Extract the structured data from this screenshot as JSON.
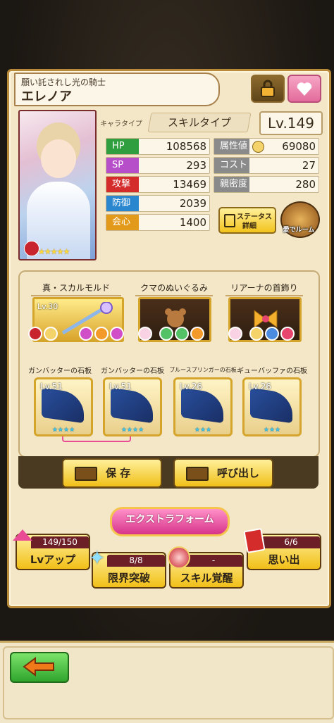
{
  "header": {
    "subtitle": "願い託されし光の騎士",
    "name": "エレノア"
  },
  "character": {
    "type_label": "キャラタイプ",
    "type_value": "スキルタイプ",
    "level": "Lv.149",
    "stars": "★★★★★"
  },
  "stats": {
    "hp_label": "HP",
    "hp": "108568",
    "sp_label": "SP",
    "sp": "293",
    "atk_label": "攻撃",
    "atk": "13469",
    "def_label": "防御",
    "def": "2039",
    "crit_label": "会心",
    "crit": "1400",
    "attr_label": "属性値",
    "attr": "69080",
    "cost_label": "コスト",
    "cost": "27",
    "affinity_label": "親密度",
    "affinity": "280"
  },
  "buttons": {
    "status_line1": "ステータス",
    "status_line2": "詳細",
    "room": "愛でルーム",
    "save": "保 存",
    "load": "呼び出し",
    "extra_form": "エクストラフォーム"
  },
  "equipment": [
    {
      "name": "真・スカルモルド",
      "level": "Lv.30"
    },
    {
      "name": "クマのぬいぐるみ",
      "level": ""
    },
    {
      "name": "リアーナの首飾り",
      "level": ""
    }
  ],
  "slates": [
    {
      "name": "ガンバッターの石板",
      "level": "Lv.51",
      "stars": "★★★★"
    },
    {
      "name": "ガンバッターの石板",
      "level": "Lv.51",
      "stars": "★★★★"
    },
    {
      "name": "ブルースプリンガーの石板",
      "level": "Lv.26",
      "stars": "★★★"
    },
    {
      "name": "ギューバッファの石板",
      "level": "Lv.26",
      "stars": "★★★"
    }
  ],
  "actions": {
    "lvup_count": "149/150",
    "lvup_label": "Lvアップ",
    "limit_count": "8/8",
    "limit_label": "限界突破",
    "skill_count": "-",
    "skill_label": "スキル覚醒",
    "memory_count": "6/6",
    "memory_label": "思い出"
  },
  "colors": {
    "hp": "#2f9e3e",
    "sp": "#b64ec9",
    "atk": "#d42b2b",
    "def": "#2a86cf",
    "crit": "#e39a1a",
    "right_stat": "#8a8a8a",
    "panel": "#f3e7c8",
    "accent_gold": "#f1bf18"
  }
}
